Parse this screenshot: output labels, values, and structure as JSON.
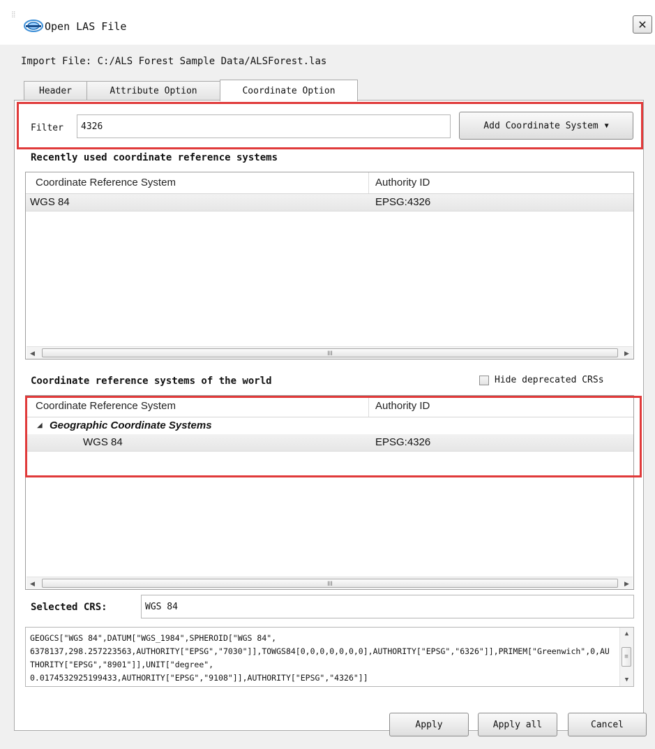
{
  "window": {
    "title": "Open LAS File",
    "close_label": "✕",
    "grip_icon": "⣿"
  },
  "import": {
    "label": "Import File:",
    "path": "C:/ALS Forest Sample Data/ALSForest.las"
  },
  "tabs": [
    {
      "label": "Header",
      "active": false
    },
    {
      "label": "Attribute Option",
      "active": false
    },
    {
      "label": "Coordinate Option",
      "active": true
    }
  ],
  "filter": {
    "label": "Filter",
    "value": "4326",
    "add_button_label": "Add Coordinate System",
    "add_button_arrow": "▼"
  },
  "recent": {
    "heading": "Recently used coordinate reference systems",
    "columns": [
      "Coordinate Reference System",
      "Authority ID"
    ],
    "rows": [
      {
        "crs": "WGS 84",
        "authority": "EPSG:4326"
      }
    ],
    "scroll_thumb": "III"
  },
  "world": {
    "heading": "Coordinate reference systems of the world",
    "hide_deprecated_label": "Hide deprecated CRSs",
    "hide_deprecated_checked": false,
    "columns": [
      "Coordinate Reference System",
      "Authority ID"
    ],
    "group": {
      "label": "Geographic Coordinate Systems",
      "expander": "◢",
      "expanded": true
    },
    "rows": [
      {
        "crs": "WGS 84",
        "authority": "EPSG:4326"
      }
    ],
    "scroll_thumb": "III"
  },
  "selected": {
    "label": "Selected CRS:",
    "value": "WGS 84",
    "wkt": "GEOGCS[\"WGS 84\",DATUM[\"WGS_1984\",SPHEROID[\"WGS 84\",\n6378137,298.257223563,AUTHORITY[\"EPSG\",\"7030\"]],TOWGS84[0,0,0,0,0,0,0],AUTHORITY[\"EPSG\",\"6326\"]],PRIMEM[\"Greenwich\",0,AUTHORITY[\"EPSG\",\"8901\"]],UNIT[\"degree\",\n0.0174532925199433,AUTHORITY[\"EPSG\",\"9108\"]],AUTHORITY[\"EPSG\",\"4326\"]]"
  },
  "buttons": {
    "apply": "Apply",
    "apply_all": "Apply all",
    "cancel": "Cancel"
  },
  "colors": {
    "highlight": "#e03a3a",
    "selected_row": "#e8e8e8"
  },
  "icons": {
    "scroll_left": "◀",
    "scroll_right": "▶",
    "scroll_up": "▲",
    "scroll_down": "▼",
    "thumb_grip": "≡"
  }
}
